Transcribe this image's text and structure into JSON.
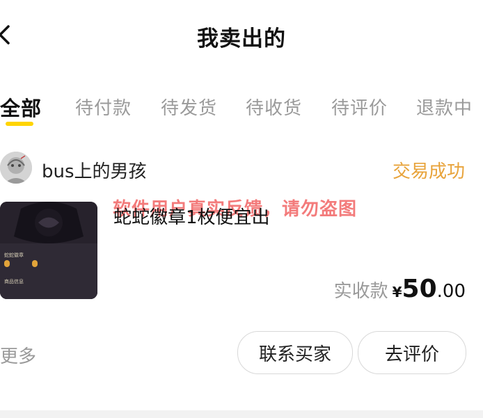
{
  "header": {
    "title": "我卖出的",
    "back_icon": "chevron-left-icon"
  },
  "tabs": [
    {
      "label": "全部",
      "active": true
    },
    {
      "label": "待付款",
      "active": false
    },
    {
      "label": "待发货",
      "active": false
    },
    {
      "label": "待收货",
      "active": false
    },
    {
      "label": "待评价",
      "active": false
    },
    {
      "label": "退款中",
      "active": false
    }
  ],
  "order": {
    "buyer_name": "bus上的男孩",
    "status": "交易成功",
    "watermark": "软件用户真实反馈，请勿盗图",
    "item_title": "蛇蛇徽章1枚便宜出",
    "price_label": "实收款",
    "currency": "¥",
    "price_int": "50",
    "price_dec": ".00"
  },
  "actions": {
    "more": "更多",
    "contact_buyer": "联系买家",
    "review": "去评价"
  },
  "colors": {
    "accent": "#ffd400",
    "status": "#e8a33a",
    "watermark": "#f05a5a"
  }
}
